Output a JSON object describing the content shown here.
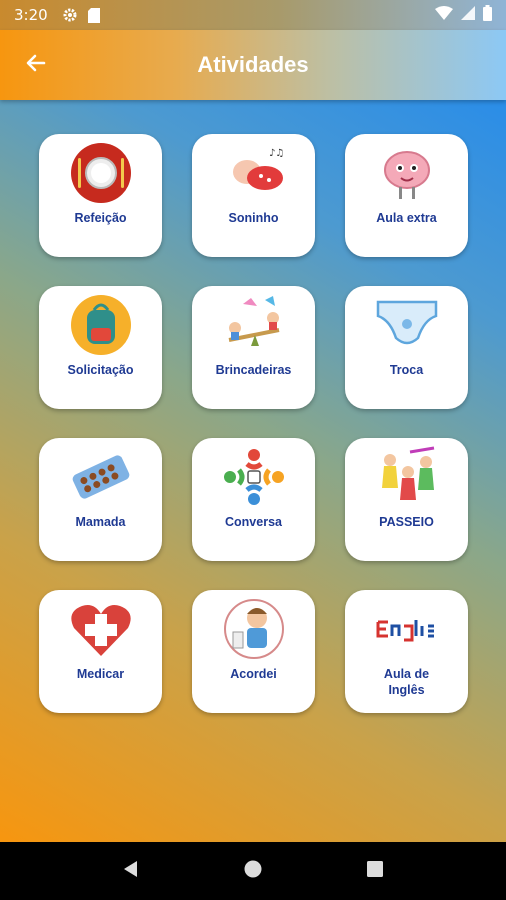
{
  "status_bar": {
    "time": "3:20"
  },
  "app_bar": {
    "title": "Atividades"
  },
  "tiles": [
    {
      "label": "Refeição",
      "icon": "plate-cutlery-icon"
    },
    {
      "label": "Soninho",
      "icon": "sleeping-baby-icon"
    },
    {
      "label": "Aula extra",
      "icon": "brain-icon"
    },
    {
      "label": "Solicitação",
      "icon": "backpack-icon"
    },
    {
      "label": "Brincadeiras",
      "icon": "kids-seesaw-icon"
    },
    {
      "label": "Troca",
      "icon": "diaper-icon"
    },
    {
      "label": "Mamada",
      "icon": "pill-strip-icon"
    },
    {
      "label": "Conversa",
      "icon": "people-circle-icon"
    },
    {
      "label": "PASSEIO",
      "icon": "kids-walking-icon"
    },
    {
      "label": "Medicar",
      "icon": "medical-heart-icon"
    },
    {
      "label": "Acordei",
      "icon": "boy-waking-icon"
    },
    {
      "label": "Aula de\nInglês",
      "icon": "english-text-icon"
    }
  ],
  "colors": {
    "label": "#1f3a93",
    "gradient_start": "#f7960f",
    "gradient_end": "#2a8de8"
  }
}
